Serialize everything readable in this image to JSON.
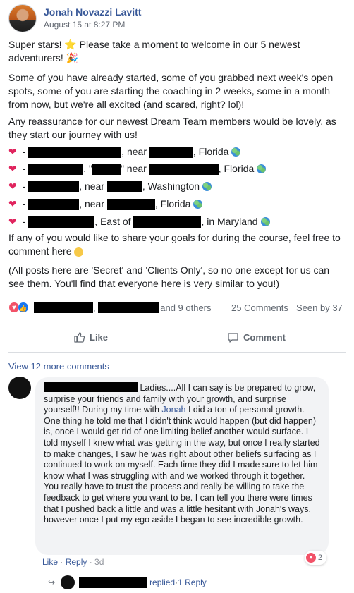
{
  "post": {
    "author": "Jonah Novazzi Lavitt",
    "time": "August 15 at 8:27 PM",
    "p1": "Super stars! ⭐ Please take a moment to welcome in our 5 newest adventurers! 🎉",
    "p2": "Some of you have already started, some of you grabbed next week's open spots, some of you are starting the coaching in 2 weeks, some in a month from now, but we're all excited (and scared, right? lol)!",
    "p3": "Any reassurance for our newest Dream Team members would be lovely, as they start our journey with us!",
    "bullets": [
      {
        "dash": " - ",
        "mid": ", near ",
        "end": ", Florida"
      },
      {
        "dash": " - ",
        "mid": ", \"",
        "mid2": "\" near ",
        "end": ", Florida"
      },
      {
        "dash": " - ",
        "mid": ", near ",
        "end": ", Washington"
      },
      {
        "dash": " - ",
        "mid": ", near ",
        "end": ", Florida"
      },
      {
        "dash": " - ",
        "mid": ", East of ",
        "end": ", in Maryland"
      }
    ],
    "p4": "If any of you would like to share your goals for during the course, feel free to comment here",
    "p5": "(All posts here are 'Secret' and 'Clients Only', so no one except for us can see them. You'll find that everyone here is very similar to you!)"
  },
  "reactions": {
    "and_others": "and 9 others",
    "comments": "25 Comments",
    "seen_by": "Seen by 37",
    "comma": ", "
  },
  "actions": {
    "like": "Like",
    "comment": "Comment"
  },
  "comments": {
    "view_more": "View 12 more comments",
    "comment1": {
      "text_before": " Ladies....All I can say is be prepared to grow, surprise your friends and family with your growth, and surprise yourself!! During my time with ",
      "mention": "Jonah",
      "text_after": " I did a ton of personal growth. One thing he told me that I didn't think would happen (but did happen) is, once I would get rid of one limiting belief another would surface. I told myself I knew what was getting in the way, but once I really started to make changes, I saw he was right about other beliefs surfacing as I continued to work on myself. Each time they did I made sure to let him know what I was struggling with and we worked through it together. You really have to trust the process and really be willing to take the feedback to get where you want to be. I can tell you there were times that I pushed back a little and was a little hesitant with Jonah's ways, however once I put my ego aside I began to see incredible growth.",
      "like": "Like",
      "sep": " · ",
      "reply": "Reply",
      "time": "3d",
      "love_count": "2"
    },
    "reply_row": {
      "replied": "replied",
      "sep": " · ",
      "count": "1 Reply"
    }
  },
  "colors": {
    "link": "#385898",
    "love": "#f25268",
    "like": "#1877f2",
    "redaction": "#000000"
  }
}
